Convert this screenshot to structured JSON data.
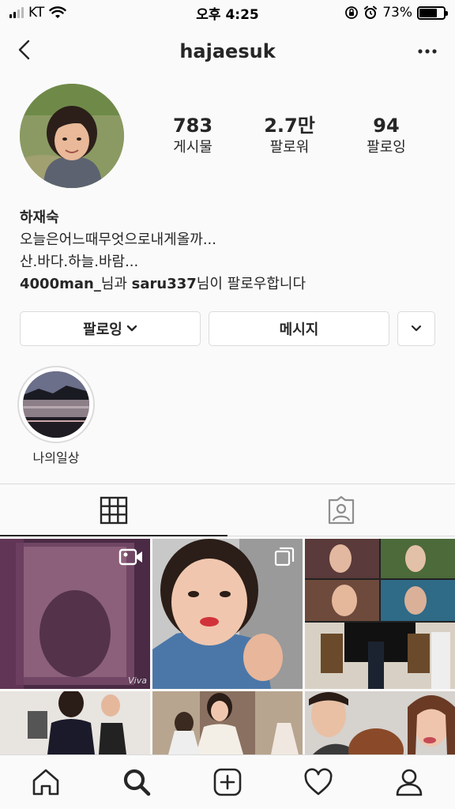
{
  "status_bar": {
    "carrier": "KT",
    "time": "오후 4:25",
    "battery_text": "73%",
    "battery_level": 0.73,
    "icons": [
      "signal-icon",
      "wifi-icon",
      "rotation-lock-icon",
      "alarm-icon",
      "battery-icon"
    ]
  },
  "header": {
    "username": "hajaesuk",
    "back_icon": "chevron-left-icon",
    "more_icon": "more-horizontal-icon"
  },
  "profile": {
    "stats": [
      {
        "value": "783",
        "label": "게시물"
      },
      {
        "value": "2.7만",
        "label": "팔로워"
      },
      {
        "value": "94",
        "label": "팔로잉"
      }
    ],
    "name": "하재숙",
    "bio_lines": [
      "오늘은어느때무엇으로내게올까...",
      "산.바다.하늘.바람..."
    ],
    "followed_by": {
      "user1": "4000man_",
      "text1": "님과 ",
      "user2": "saru337",
      "text2": "님이 팔로우합니다"
    }
  },
  "buttons": {
    "following_label": "팔로잉",
    "message_label": "메시지"
  },
  "highlights": [
    {
      "label": "나의일상"
    }
  ],
  "tabs": [
    {
      "icon": "grid-icon",
      "active": true
    },
    {
      "icon": "tagged-icon",
      "active": false
    }
  ],
  "grid_overlays": {
    "cell1_watermark": "Viva"
  },
  "bottom_nav": [
    "home-icon",
    "search-icon",
    "add-post-icon",
    "heart-icon",
    "profile-icon"
  ],
  "colors": {
    "text": "#262626",
    "border": "#dbdbdb",
    "background": "#fafafa"
  }
}
